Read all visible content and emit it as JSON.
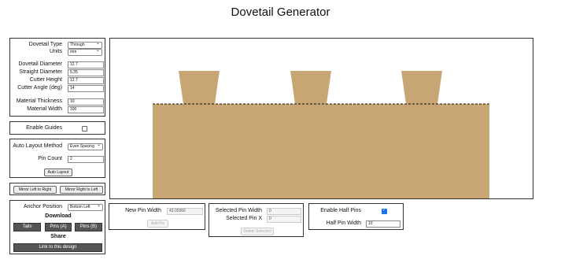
{
  "page_title": "Dovetail Generator",
  "settings": {
    "dovetail_type_label": "Dovetail Type",
    "dovetail_type_value": "Through",
    "units_label": "Units",
    "units_value": "mm",
    "dovetail_diameter_label": "Dovetail Diameter",
    "dovetail_diameter_value": "12.7",
    "straight_diameter_label": "Straight Diameter",
    "straight_diameter_value": "6.35",
    "cutter_height_label": "Cutter Height",
    "cutter_height_value": "12.7",
    "cutter_angle_label": "Cutter Angle (deg)",
    "cutter_angle_value": "14",
    "material_thickness_label": "Material Thickness",
    "material_thickness_value": "10",
    "material_width_label": "Material Width",
    "material_width_value": "100"
  },
  "guides": {
    "label": "Enable Guides",
    "checked": false
  },
  "auto_layout": {
    "method_label": "Auto Layout Method",
    "method_value": "Even Spacing",
    "pin_count_label": "Pin Count",
    "pin_count_value": "2",
    "button_label": "Auto Layout"
  },
  "mirror": {
    "left_to_right": "Mirror Left to Right",
    "right_to_left": "Mirror Right to Left"
  },
  "export": {
    "anchor_label": "Anchor Position",
    "anchor_value": "Bottom Left",
    "download_heading": "Download",
    "tails_label": "Tails",
    "pins_a_label": "Pins (A)",
    "pins_b_label": "Pins (B)",
    "share_heading": "Share",
    "link_label": "Link to this design"
  },
  "new_pin": {
    "width_label": "New Pin Width",
    "width_value": "43.05966",
    "add_label": "Add Pin"
  },
  "selected_pin": {
    "width_label": "Selected Pin Width",
    "width_value": "0",
    "x_label": "Selected Pin X",
    "x_value": "0",
    "delete_label": "Delete Selected"
  },
  "half_pins": {
    "enable_label": "Enable Half Pins",
    "enable_checked": true,
    "width_label": "Half Pin Width",
    "width_value": "10"
  },
  "colors": {
    "wood": "#c8a674",
    "board_border": "#333333",
    "checkbox_on": "#1a73e8"
  }
}
